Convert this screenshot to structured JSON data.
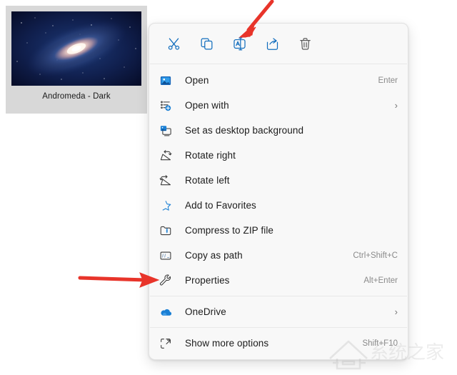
{
  "desktop": {
    "thumbnail": {
      "caption": "Andromeda - Dark",
      "image_alt": "andromeda-galaxy-thumbnail"
    }
  },
  "context_menu": {
    "toolbar": [
      {
        "name": "cut-icon",
        "label": "Cut"
      },
      {
        "name": "copy-icon",
        "label": "Copy"
      },
      {
        "name": "rename-icon",
        "label": "Rename"
      },
      {
        "name": "share-icon",
        "label": "Share"
      },
      {
        "name": "delete-icon",
        "label": "Delete"
      }
    ],
    "items": [
      {
        "icon": "photo-icon",
        "label": "Open",
        "accel": "Enter",
        "submenu": false
      },
      {
        "icon": "open-with-icon",
        "label": "Open with",
        "accel": "",
        "submenu": true
      },
      {
        "icon": "desktop-background-icon",
        "label": "Set as desktop background",
        "accel": "",
        "submenu": false
      },
      {
        "icon": "rotate-right-icon",
        "label": "Rotate right",
        "accel": "",
        "submenu": false
      },
      {
        "icon": "rotate-left-icon",
        "label": "Rotate left",
        "accel": "",
        "submenu": false
      },
      {
        "icon": "star-icon",
        "label": "Add to Favorites",
        "accel": "",
        "submenu": false
      },
      {
        "icon": "zip-icon",
        "label": "Compress to ZIP file",
        "accel": "",
        "submenu": false
      },
      {
        "icon": "copy-path-icon",
        "label": "Copy as path",
        "accel": "Ctrl+Shift+C",
        "submenu": false
      },
      {
        "icon": "wrench-icon",
        "label": "Properties",
        "accel": "Alt+Enter",
        "submenu": false
      }
    ],
    "onedrive": {
      "icon": "cloud-icon",
      "label": "OneDrive",
      "accel": "",
      "submenu": true
    },
    "more": {
      "icon": "show-more-icon",
      "label": "Show more options",
      "accel": "Shift+F10",
      "submenu": false
    },
    "chevron_glyph": "›"
  },
  "annotations": [
    {
      "name": "arrow-pointing-to-rename-icon",
      "color": "#e8342a"
    },
    {
      "name": "arrow-pointing-to-properties",
      "color": "#e8342a"
    }
  ],
  "watermark": {
    "text": "系统之家"
  },
  "colors": {
    "accent_blue": "#0f6cbd",
    "panel_bg": "#f8f8f8",
    "tile_bg": "#d8d8d8",
    "text": "#1b1b1b",
    "accel_text": "#8a8a8a",
    "separator": "#e8e8e8",
    "arrow_red": "#e8342a"
  }
}
